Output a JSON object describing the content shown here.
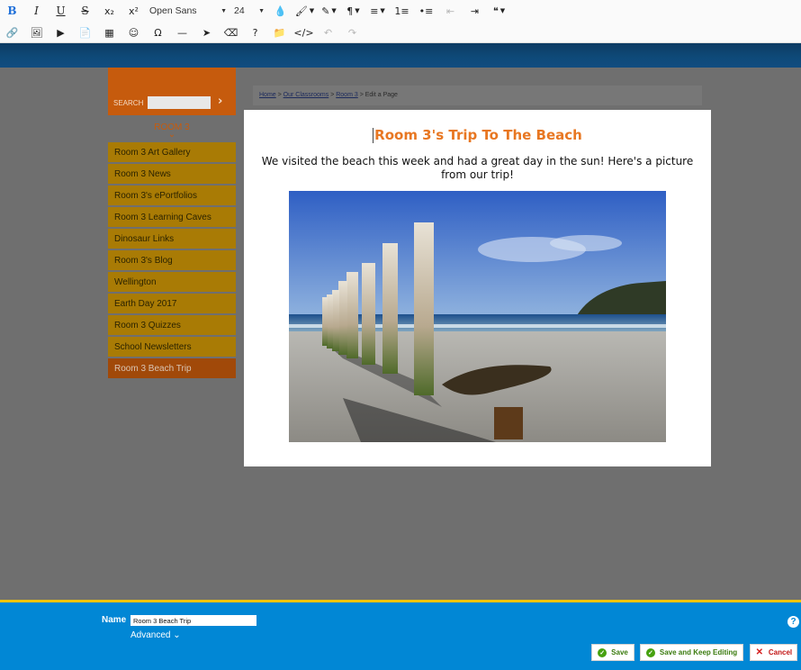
{
  "toolbar": {
    "row1": [
      {
        "name": "bold-button",
        "glyph": "B"
      },
      {
        "name": "italic-button",
        "glyph": "I"
      },
      {
        "name": "underline-button",
        "glyph": "U"
      },
      {
        "name": "strikethrough-button",
        "glyph": "S"
      },
      {
        "name": "subscript-button",
        "glyph": "x₂"
      },
      {
        "name": "superscript-button",
        "glyph": "x²"
      }
    ],
    "font_family": "Open Sans",
    "font_size": "24",
    "row1_right": [
      {
        "name": "text-color-button",
        "glyph": "💧"
      },
      {
        "name": "paint-brush-button",
        "glyph": "🖌"
      },
      {
        "name": "magic-wand-button",
        "glyph": "✎"
      },
      {
        "name": "paragraph-button",
        "glyph": "¶"
      },
      {
        "name": "align-button",
        "glyph": "≡"
      },
      {
        "name": "ordered-list-button",
        "glyph": "1≡"
      },
      {
        "name": "unordered-list-button",
        "glyph": "•≡"
      },
      {
        "name": "outdent-button",
        "glyph": "⇤"
      },
      {
        "name": "indent-button",
        "glyph": "⇥"
      },
      {
        "name": "quote-button",
        "glyph": "❝"
      }
    ],
    "row2": [
      {
        "name": "link-button",
        "glyph": "🔗"
      },
      {
        "name": "image-button",
        "glyph": "🖼"
      },
      {
        "name": "video-button",
        "glyph": "▶"
      },
      {
        "name": "file-button",
        "glyph": "📄"
      },
      {
        "name": "table-button",
        "glyph": "▦"
      },
      {
        "name": "emoticon-button",
        "glyph": "☺"
      },
      {
        "name": "special-char-button",
        "glyph": "Ω"
      },
      {
        "name": "horizontal-line-button",
        "glyph": "—"
      },
      {
        "name": "select-all-button",
        "glyph": "➤"
      },
      {
        "name": "clear-format-button",
        "glyph": "⌫"
      },
      {
        "name": "help-button",
        "glyph": "?"
      },
      {
        "name": "folder-button",
        "glyph": "📁"
      },
      {
        "name": "code-view-button",
        "glyph": "</>"
      },
      {
        "name": "undo-button",
        "glyph": "↶"
      },
      {
        "name": "redo-button",
        "glyph": "↷"
      }
    ]
  },
  "sidebar": {
    "search_label": "SEARCH",
    "section_title": "ROOM 3",
    "items": [
      {
        "label": "Room 3 Art Gallery",
        "active": false
      },
      {
        "label": "Room 3 News",
        "active": false
      },
      {
        "label": "Room 3's ePortfolios",
        "active": false
      },
      {
        "label": "Room 3 Learning Caves",
        "active": false
      },
      {
        "label": "Dinosaur Links",
        "active": false
      },
      {
        "label": "Room 3's Blog",
        "active": false
      },
      {
        "label": "Wellington",
        "active": false
      },
      {
        "label": "Earth Day 2017",
        "active": false
      },
      {
        "label": "Room 3 Quizzes",
        "active": false
      },
      {
        "label": "School Newsletters",
        "active": false
      },
      {
        "label": "Room 3 Beach Trip",
        "active": true
      }
    ]
  },
  "breadcrumb": {
    "home": "Home",
    "sep": " > ",
    "classrooms": "Our Classrooms",
    "room": "Room 3",
    "current": "Edit a Page"
  },
  "editor": {
    "heading": "Room 3's Trip To The Beach",
    "body": "We visited the beach this week and had a great day in the sun! Here's a picture from our trip!"
  },
  "footer": {
    "name_label": "Name",
    "name_value": "Room 3 Beach Trip",
    "advanced_label": "Advanced",
    "help": "?",
    "save_label": "Save",
    "save_keep_label": "Save and Keep Editing",
    "cancel_label": "Cancel"
  },
  "colors": {
    "heading": "#e87722",
    "sidebar_item": "#a97b05",
    "sidebar_active": "#a14909",
    "bottom_bar": "#0187d5",
    "bottom_border": "#f2c400"
  }
}
